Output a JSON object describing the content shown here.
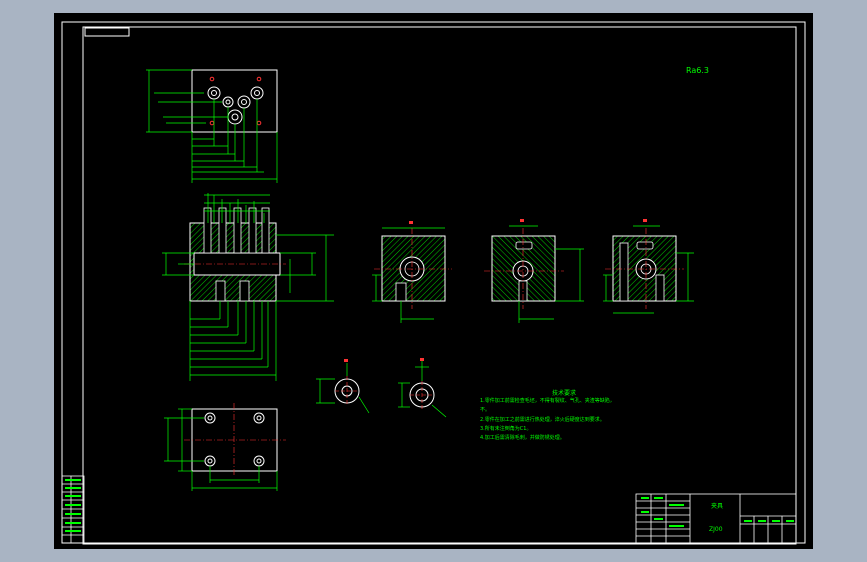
{
  "drawing": {
    "roughness_symbol": "Ra6.3",
    "tech_requirements": {
      "title": "技术要求",
      "items": [
        "1.零件加工前需检查毛坯，不得有裂纹、气孔、夹渣等缺陷，",
        "不。",
        "2.零件在加工之前需进行热处理，淬火后硬度达到要求。",
        "3.所有未注倒角为C1。",
        "4.加工后需清除毛刺，并做防锈处理。"
      ]
    },
    "title_block": {
      "name": "夹具",
      "code": "ZJ00"
    },
    "colors": {
      "background": "#000000",
      "frame": "#ffffff",
      "dimension": "#00ff00",
      "hatch": "#00ff00",
      "center_line": "#ff0000",
      "section_label": "#ff0000",
      "text": "#00ff00",
      "viewport_surround": "#a9b4c3"
    }
  }
}
